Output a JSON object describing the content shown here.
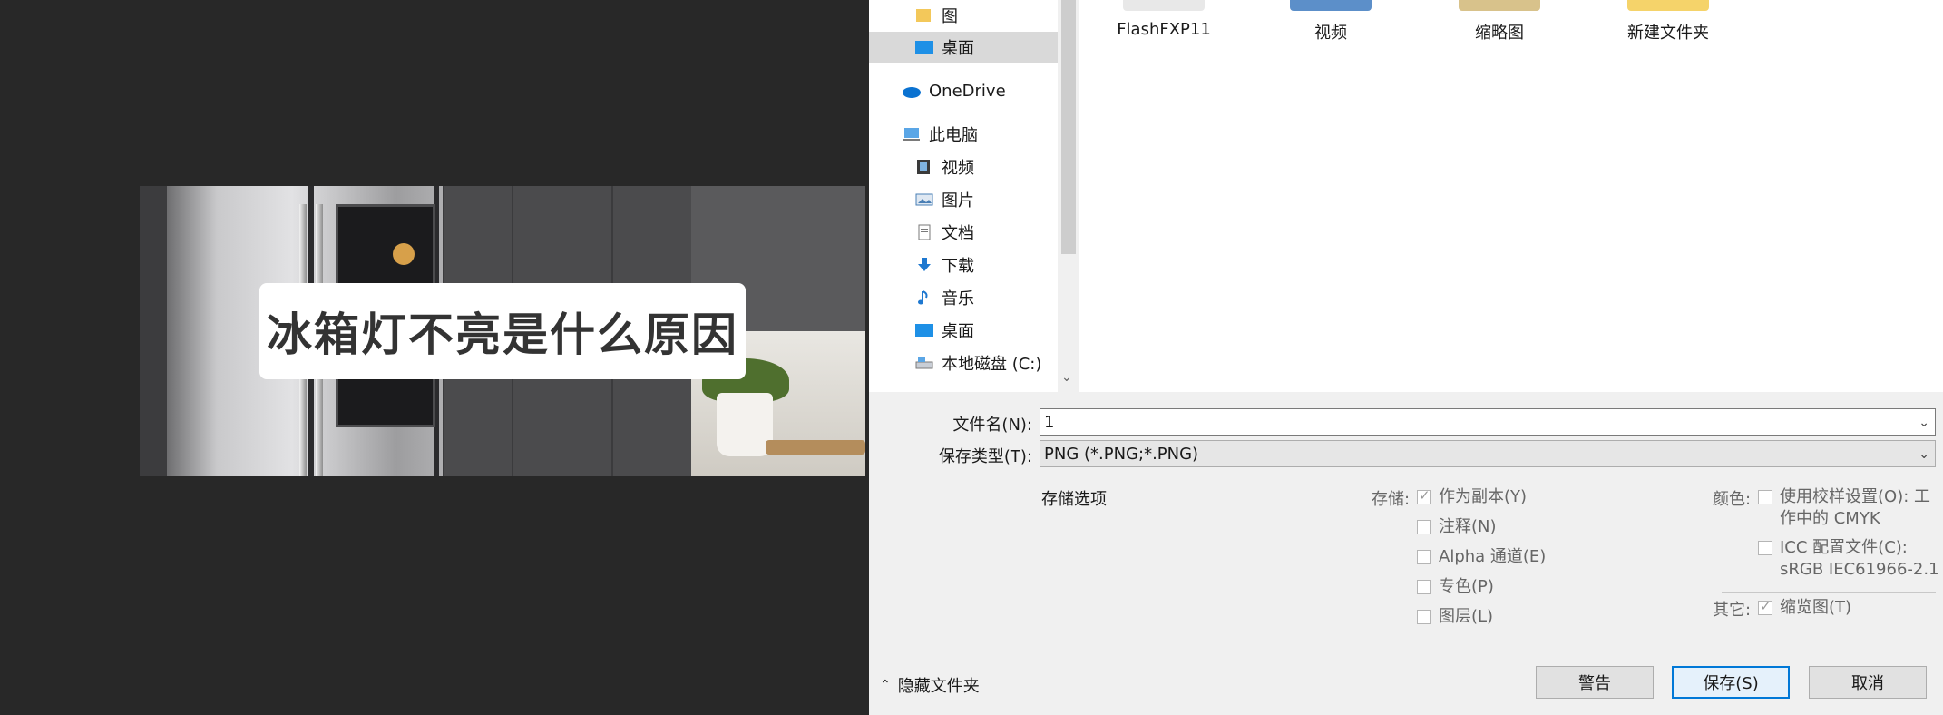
{
  "canvas": {
    "overlay_title": "冰箱灯不亮是什么原因"
  },
  "dialog": {
    "nav": {
      "items": [
        {
          "label": "图",
          "icon": "folder-icon"
        },
        {
          "label": "桌面",
          "icon": "desktop-icon",
          "selected": true
        },
        {
          "label": "OneDrive",
          "icon": "cloud-icon"
        },
        {
          "label": "此电脑",
          "icon": "computer-icon"
        },
        {
          "label": "视频",
          "icon": "video-icon"
        },
        {
          "label": "图片",
          "icon": "pictures-icon"
        },
        {
          "label": "文档",
          "icon": "documents-icon"
        },
        {
          "label": "下载",
          "icon": "download-icon"
        },
        {
          "label": "音乐",
          "icon": "music-icon"
        },
        {
          "label": "桌面",
          "icon": "desktop-icon"
        },
        {
          "label": "本地磁盘 (C:)",
          "icon": "drive-icon"
        }
      ]
    },
    "folders": [
      "FlashFXP11",
      "视频",
      "缩略图",
      "新建文件夹"
    ],
    "filename_label": "文件名(N):",
    "filename_value": "1",
    "filetype_label": "保存类型(T):",
    "filetype_value": "PNG (*.PNG;*.PNG)",
    "options": {
      "header": "存储选项",
      "storage_label": "存储:",
      "storage_items": [
        {
          "label": "作为副本(Y)",
          "checked": true
        },
        {
          "label": "注释(N)",
          "checked": false
        },
        {
          "label": "Alpha 通道(E)",
          "checked": false
        },
        {
          "label": "专色(P)",
          "checked": false
        },
        {
          "label": "图层(L)",
          "checked": false
        }
      ],
      "color_label": "颜色:",
      "color_items": [
        {
          "line1": "使用校样设置(O): 工",
          "line2": "作中的 CMYK",
          "checked": false
        },
        {
          "line1": "ICC 配置文件(C):",
          "line2": "sRGB IEC61966-2.1",
          "checked": false
        }
      ],
      "other_label": "其它:",
      "other_items": [
        {
          "label": "缩览图(T)",
          "checked": true
        }
      ]
    },
    "hide_folders_label": "隐藏文件夹",
    "buttons": {
      "warning": "警告",
      "save": "保存(S)",
      "cancel": "取消"
    }
  },
  "colors": {
    "canvas_bg": "#282828",
    "dialog_bg": "#f0f0f0",
    "accent": "#0078d7"
  }
}
